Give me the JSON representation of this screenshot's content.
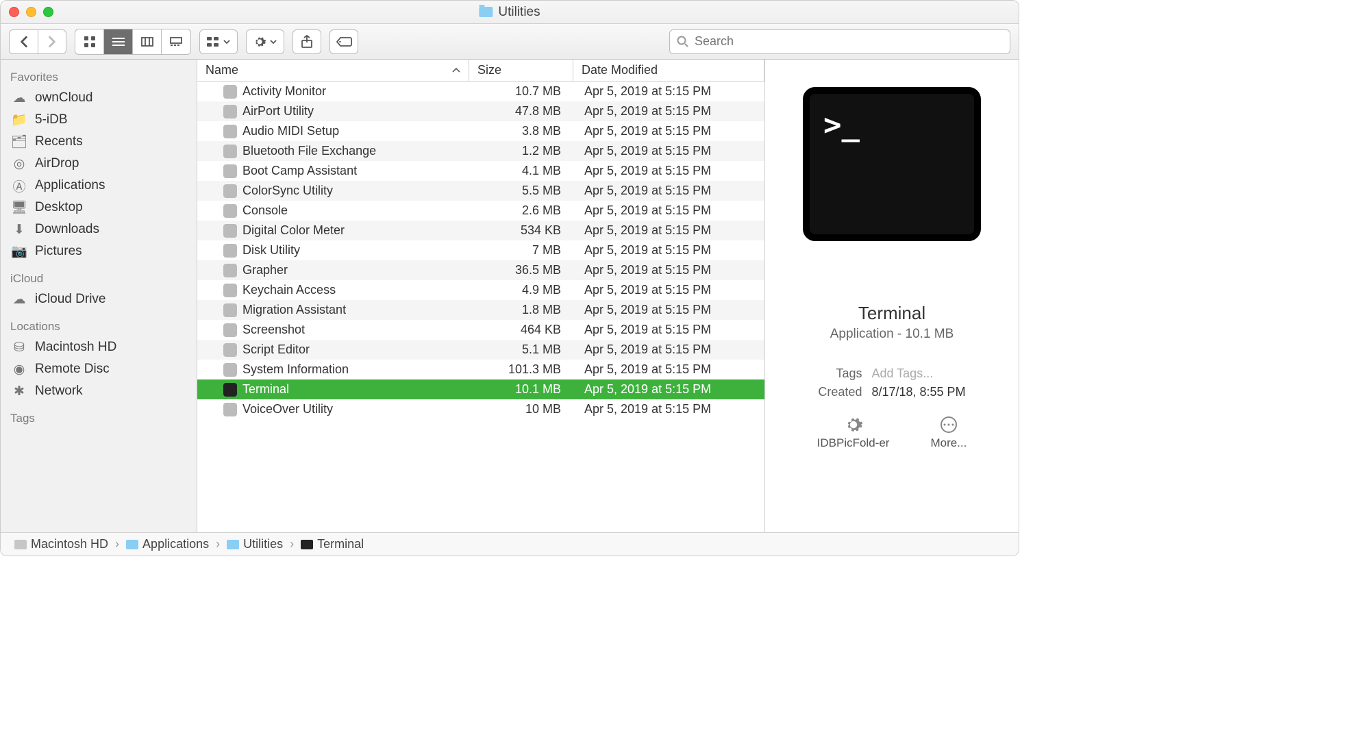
{
  "window": {
    "title": "Utilities"
  },
  "search": {
    "placeholder": "Search"
  },
  "sidebar": {
    "favorites_label": "Favorites",
    "favorites": [
      {
        "name": "ownCloud"
      },
      {
        "name": "5-iDB"
      },
      {
        "name": "Recents"
      },
      {
        "name": "AirDrop"
      },
      {
        "name": "Applications"
      },
      {
        "name": "Desktop"
      },
      {
        "name": "Downloads"
      },
      {
        "name": "Pictures"
      }
    ],
    "icloud_label": "iCloud",
    "icloud": [
      {
        "name": "iCloud Drive"
      }
    ],
    "locations_label": "Locations",
    "locations": [
      {
        "name": "Macintosh HD"
      },
      {
        "name": "Remote Disc"
      },
      {
        "name": "Network"
      }
    ],
    "tags_label": "Tags"
  },
  "columns": {
    "name": "Name",
    "size": "Size",
    "date": "Date Modified"
  },
  "files": [
    {
      "name": "Activity Monitor",
      "size": "10.7 MB",
      "date": "Apr 5, 2019 at 5:15 PM",
      "selected": false
    },
    {
      "name": "AirPort Utility",
      "size": "47.8 MB",
      "date": "Apr 5, 2019 at 5:15 PM",
      "selected": false
    },
    {
      "name": "Audio MIDI Setup",
      "size": "3.8 MB",
      "date": "Apr 5, 2019 at 5:15 PM",
      "selected": false
    },
    {
      "name": "Bluetooth File Exchange",
      "size": "1.2 MB",
      "date": "Apr 5, 2019 at 5:15 PM",
      "selected": false
    },
    {
      "name": "Boot Camp Assistant",
      "size": "4.1 MB",
      "date": "Apr 5, 2019 at 5:15 PM",
      "selected": false
    },
    {
      "name": "ColorSync Utility",
      "size": "5.5 MB",
      "date": "Apr 5, 2019 at 5:15 PM",
      "selected": false
    },
    {
      "name": "Console",
      "size": "2.6 MB",
      "date": "Apr 5, 2019 at 5:15 PM",
      "selected": false
    },
    {
      "name": "Digital Color Meter",
      "size": "534 KB",
      "date": "Apr 5, 2019 at 5:15 PM",
      "selected": false
    },
    {
      "name": "Disk Utility",
      "size": "7 MB",
      "date": "Apr 5, 2019 at 5:15 PM",
      "selected": false
    },
    {
      "name": "Grapher",
      "size": "36.5 MB",
      "date": "Apr 5, 2019 at 5:15 PM",
      "selected": false
    },
    {
      "name": "Keychain Access",
      "size": "4.9 MB",
      "date": "Apr 5, 2019 at 5:15 PM",
      "selected": false
    },
    {
      "name": "Migration Assistant",
      "size": "1.8 MB",
      "date": "Apr 5, 2019 at 5:15 PM",
      "selected": false
    },
    {
      "name": "Screenshot",
      "size": "464 KB",
      "date": "Apr 5, 2019 at 5:15 PM",
      "selected": false
    },
    {
      "name": "Script Editor",
      "size": "5.1 MB",
      "date": "Apr 5, 2019 at 5:15 PM",
      "selected": false
    },
    {
      "name": "System Information",
      "size": "101.3 MB",
      "date": "Apr 5, 2019 at 5:15 PM",
      "selected": false
    },
    {
      "name": "Terminal",
      "size": "10.1 MB",
      "date": "Apr 5, 2019 at 5:15 PM",
      "selected": true
    },
    {
      "name": "VoiceOver Utility",
      "size": "10 MB",
      "date": "Apr 5, 2019 at 5:15 PM",
      "selected": false
    }
  ],
  "preview": {
    "name": "Terminal",
    "info": "Application - 10.1 MB",
    "tags_label": "Tags",
    "tags_placeholder": "Add Tags...",
    "created_label": "Created",
    "created_value": "8/17/18, 8:55 PM",
    "action1": "IDBPicFold-er",
    "action2": "More..."
  },
  "path": [
    {
      "name": "Macintosh HD"
    },
    {
      "name": "Applications"
    },
    {
      "name": "Utilities"
    },
    {
      "name": "Terminal"
    }
  ]
}
